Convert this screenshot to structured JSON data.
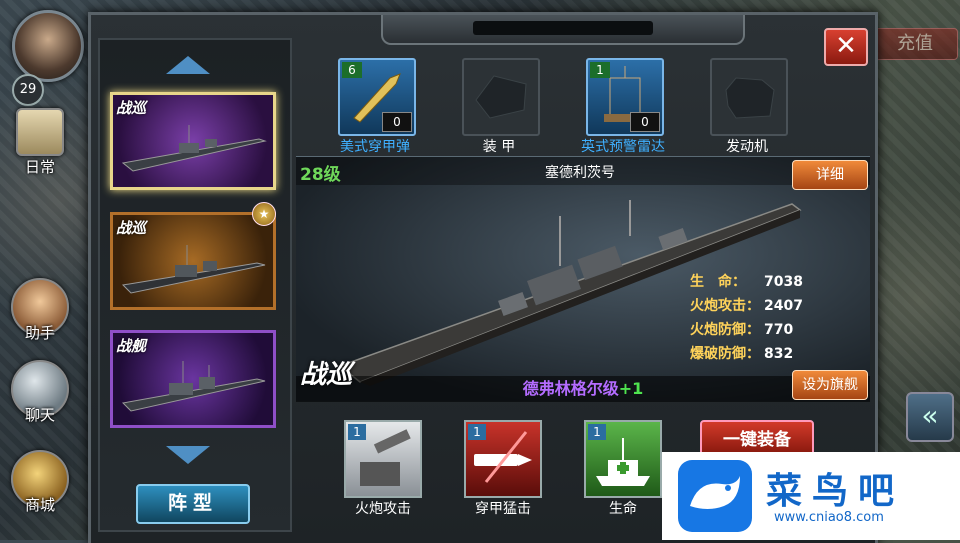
{
  "player": {
    "level": "29"
  },
  "side_menu": {
    "daily": "日常",
    "assistant": "助手",
    "chat": "聊天",
    "shop": "商城"
  },
  "header": {
    "recharge": "充值",
    "close": "✕"
  },
  "ship_list": {
    "cards": [
      {
        "type": "战巡",
        "selected": true,
        "rarity": "purple"
      },
      {
        "type": "战巡",
        "selected": false,
        "rarity": "orange"
      },
      {
        "type": "战舰",
        "selected": false,
        "rarity": "purple"
      }
    ],
    "formation_button": "阵型"
  },
  "equipment": [
    {
      "name": "美式穿甲弹",
      "count": "6",
      "quantity": "0",
      "filled": true
    },
    {
      "name": "装 甲",
      "filled": false
    },
    {
      "name": "英式预警雷达",
      "count": "1",
      "quantity": "0",
      "filled": true
    },
    {
      "name": "发动机",
      "filled": false
    }
  ],
  "ship": {
    "level": "28级",
    "name": "塞德利茨号",
    "detail_button": "详细",
    "type": "战巡",
    "class_name": "德弗林格尔级",
    "class_plus": "+1",
    "flagship_button": "设为旗舰",
    "stats": [
      {
        "label": "生　命：",
        "value": "7038"
      },
      {
        "label": "火炮攻击：",
        "value": "2407"
      },
      {
        "label": "火炮防御：",
        "value": "770"
      },
      {
        "label": "爆破防御：",
        "value": "832"
      }
    ]
  },
  "skills": [
    {
      "name": "火炮攻击",
      "count": "1",
      "icon": "cannon-icon"
    },
    {
      "name": "穿甲猛击",
      "count": "1",
      "icon": "shell-icon"
    },
    {
      "name": "生命",
      "count": "1",
      "icon": "hospital-ship-icon"
    }
  ],
  "equip_all_button": "一键装备",
  "watermark": {
    "title": "菜鸟吧",
    "url": "www.cniao8.com"
  }
}
